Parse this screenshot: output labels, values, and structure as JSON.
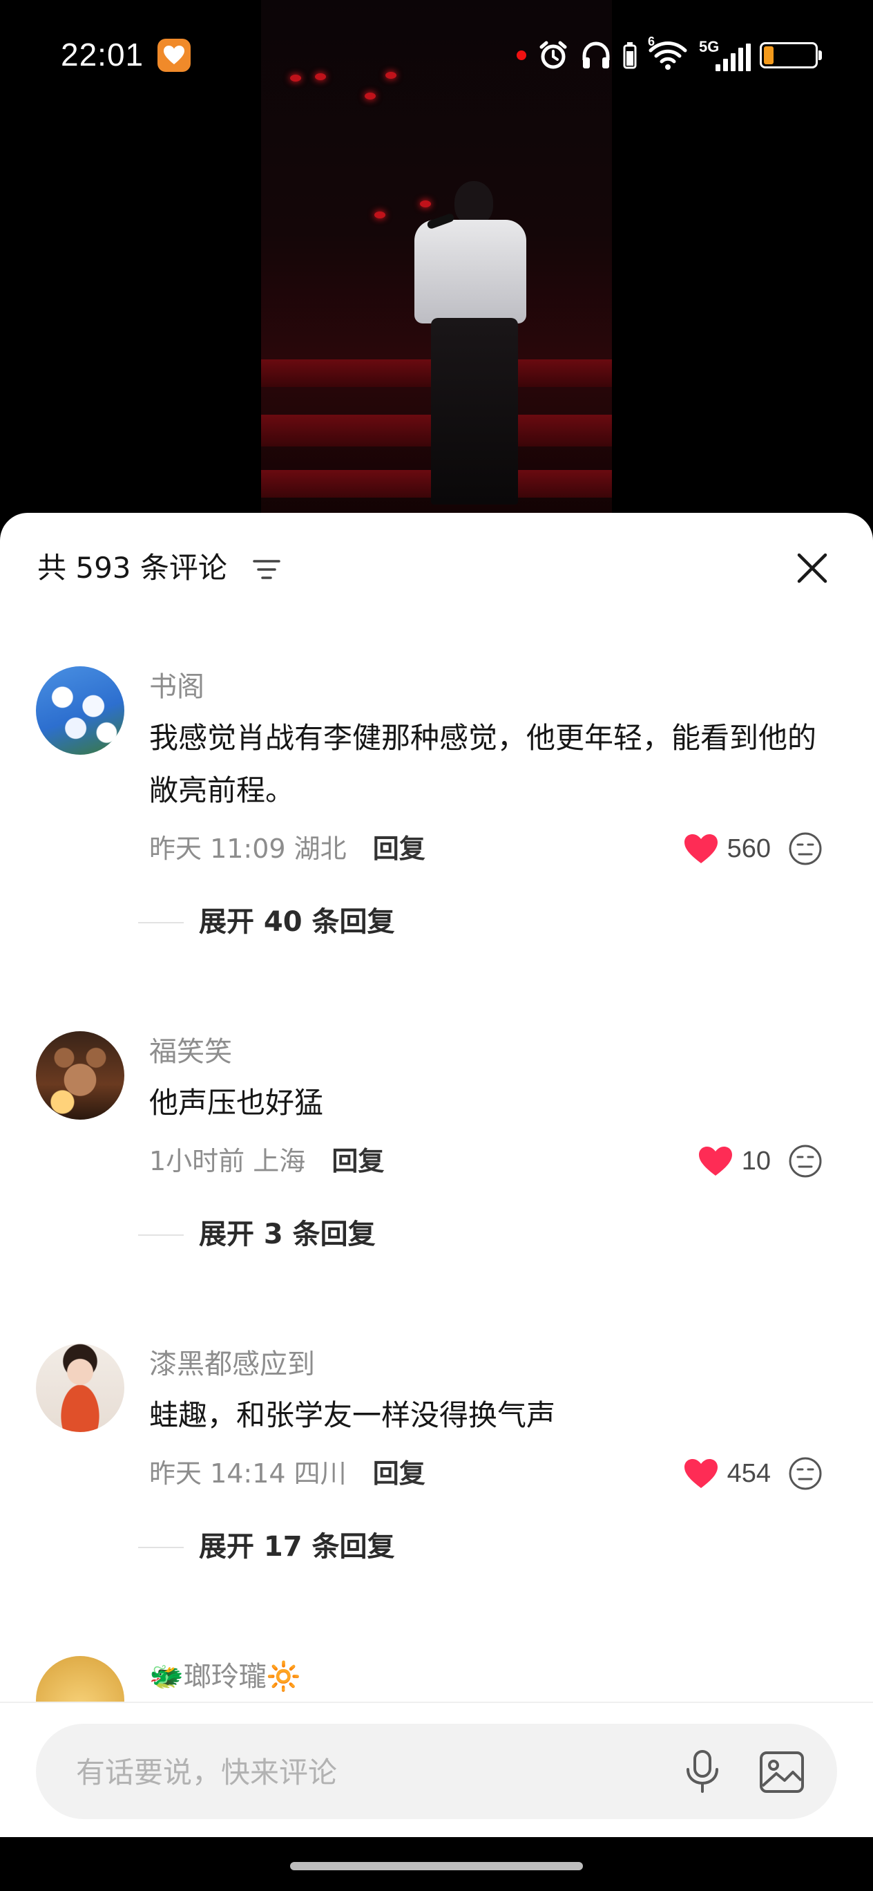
{
  "status_bar": {
    "time": "22:01",
    "network_label": "5G",
    "wifi_label": "6",
    "icons": [
      "heart-app-icon",
      "alarm-icon",
      "headphones-icon",
      "wifi-icon",
      "signal-icon",
      "battery-icon"
    ]
  },
  "comment_sheet": {
    "title": "共 593 条评论",
    "icons": [
      "sort-icon",
      "close-icon"
    ]
  },
  "comments": [
    {
      "username": "书阁",
      "text": "我感觉肖战有李健那种感觉，他更年轻，能看到他的敞亮前程。",
      "time": "昨天 11:09 湖北",
      "reply_label": "回复",
      "likes": "560",
      "expand_label": "展开 40 条回复",
      "avatar": "sky-clouds-avatar"
    },
    {
      "username": "福笑笑",
      "text": "他声压也好猛",
      "time": "1小时前 上海",
      "reply_label": "回复",
      "likes": "10",
      "expand_label": "展开 3 条回复",
      "avatar": "bear-avatar"
    },
    {
      "username": "漆黑都感应到",
      "text": "蛙趣，和张学友一样没得换气声",
      "time": "昨天 14:14 四川",
      "reply_label": "回复",
      "likes": "454",
      "expand_label": "展开 17 条回复",
      "avatar": "girl-avatar"
    },
    {
      "username": "🐲瑯玲瓏🔆",
      "avatar": "gold-avatar"
    }
  ],
  "input_bar": {
    "placeholder": "有话要说，快来评论",
    "icons": [
      "mic-icon",
      "image-icon"
    ]
  },
  "colors": {
    "like_red": "#fe2c55",
    "battery_orange": "#f39a1c",
    "muted_text": "#8d8d8d",
    "primary_text": "#161616"
  },
  "battery_level": 0.2
}
